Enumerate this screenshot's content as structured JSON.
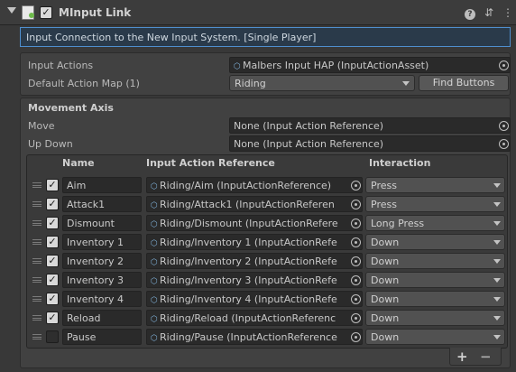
{
  "header": {
    "title": "MInput Link",
    "enabled": true
  },
  "description": "Input Connection to the New Input System. [Single Player]",
  "settings": {
    "input_actions_label": "Input Actions",
    "input_actions_value": "Malbers Input HAP (InputActionAsset)",
    "default_action_map_label": "Default Action Map (1)",
    "default_action_map_value": "Riding",
    "find_buttons_label": "Find Buttons"
  },
  "movement_axis": {
    "title": "Movement Axis",
    "move_label": "Move",
    "move_value": "None (Input Action Reference)",
    "updown_label": "Up Down",
    "updown_value": "None (Input Action Reference)"
  },
  "table": {
    "columns": [
      "Name",
      "Input Action Reference",
      "Interaction"
    ],
    "rows": [
      {
        "enabled": true,
        "name": "Aim",
        "reference": "Riding/Aim (InputActionReference)",
        "interaction": "Press"
      },
      {
        "enabled": true,
        "name": "Attack1",
        "reference": "Riding/Attack1 (InputActionReferen",
        "interaction": "Press"
      },
      {
        "enabled": true,
        "name": "Dismount",
        "reference": "Riding/Dismount (InputActionRefere",
        "interaction": "Long Press"
      },
      {
        "enabled": true,
        "name": "Inventory 1",
        "reference": "Riding/Inventory 1 (InputActionRefe",
        "interaction": "Down"
      },
      {
        "enabled": true,
        "name": "Inventory 2",
        "reference": "Riding/Inventory 2 (InputActionRefe",
        "interaction": "Down"
      },
      {
        "enabled": true,
        "name": "Inventory 3",
        "reference": "Riding/Inventory 3 (InputActionRefe",
        "interaction": "Down"
      },
      {
        "enabled": true,
        "name": "Inventory 4",
        "reference": "Riding/Inventory 4 (InputActionRefe",
        "interaction": "Down"
      },
      {
        "enabled": true,
        "name": "Reload",
        "reference": "Riding/Reload (InputActionReferenc",
        "interaction": "Down"
      },
      {
        "enabled": false,
        "name": "Pause",
        "reference": "Riding/Pause (InputActionReference",
        "interaction": "Down"
      }
    ]
  },
  "footer": {
    "add_label": "+",
    "remove_label": "−"
  }
}
